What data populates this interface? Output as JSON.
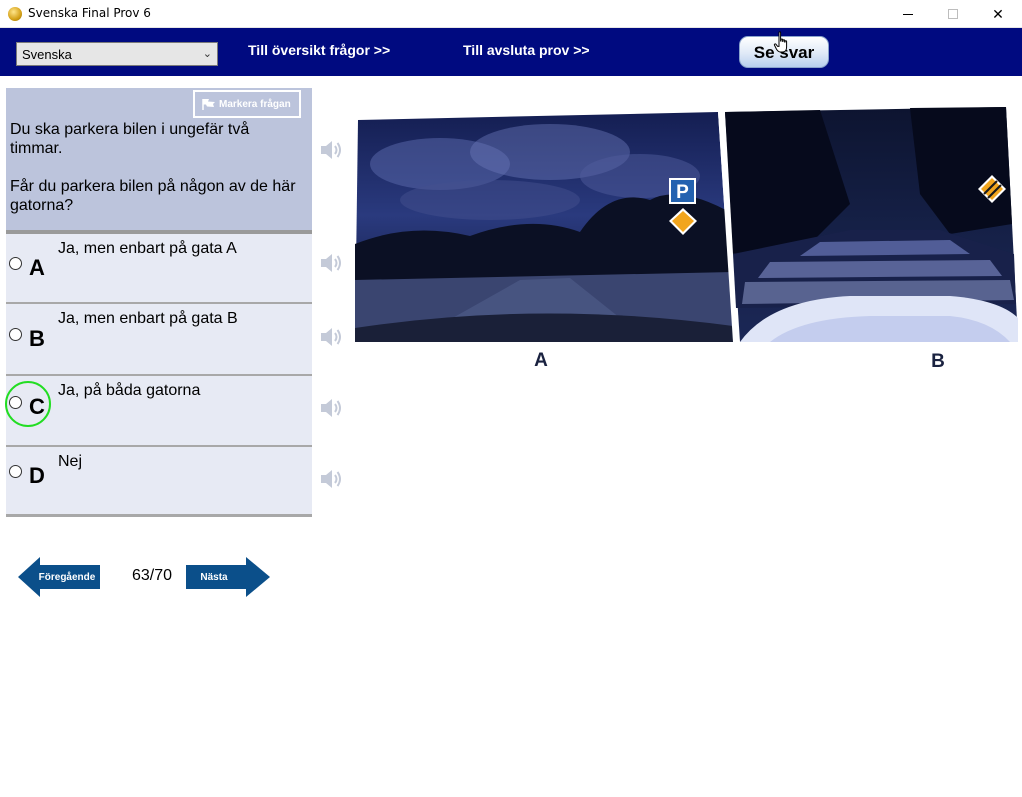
{
  "window": {
    "title": "Svenska Final Prov 6",
    "minimize_icon": "minimize-icon",
    "maximize_icon": "maximize-icon",
    "close_glyph": "✕"
  },
  "toolbar": {
    "language_selected": "Svenska",
    "overview_link": "Till översikt frågor >>",
    "finish_link": "Till avsluta prov  >>",
    "show_answer_button": "Se svar",
    "background_color": "#000a80"
  },
  "question": {
    "mark_button": "Markera frågan",
    "lines": [
      "Du ska parkera bilen i ungefär två timmar.",
      "Får du parkera bilen på någon av de här gatorna?"
    ]
  },
  "answers": [
    {
      "letter": "A",
      "text": "Ja, men enbart på gata A"
    },
    {
      "letter": "B",
      "text": "Ja, men enbart på gata B"
    },
    {
      "letter": "C",
      "text": "Ja, på båda gatorna"
    },
    {
      "letter": "D",
      "text": "Nej"
    }
  ],
  "navigation": {
    "previous": "Föregående",
    "next": "Nästa",
    "progress": "63/70",
    "arrow_color": "#0b4f8a"
  },
  "picture": {
    "label_a": "A",
    "label_b": "B",
    "sign_p": "P"
  },
  "colors": {
    "question_bg": "#bcc4dc",
    "answer_bg": "#e7eaf4",
    "highlight": "#22dd22"
  }
}
